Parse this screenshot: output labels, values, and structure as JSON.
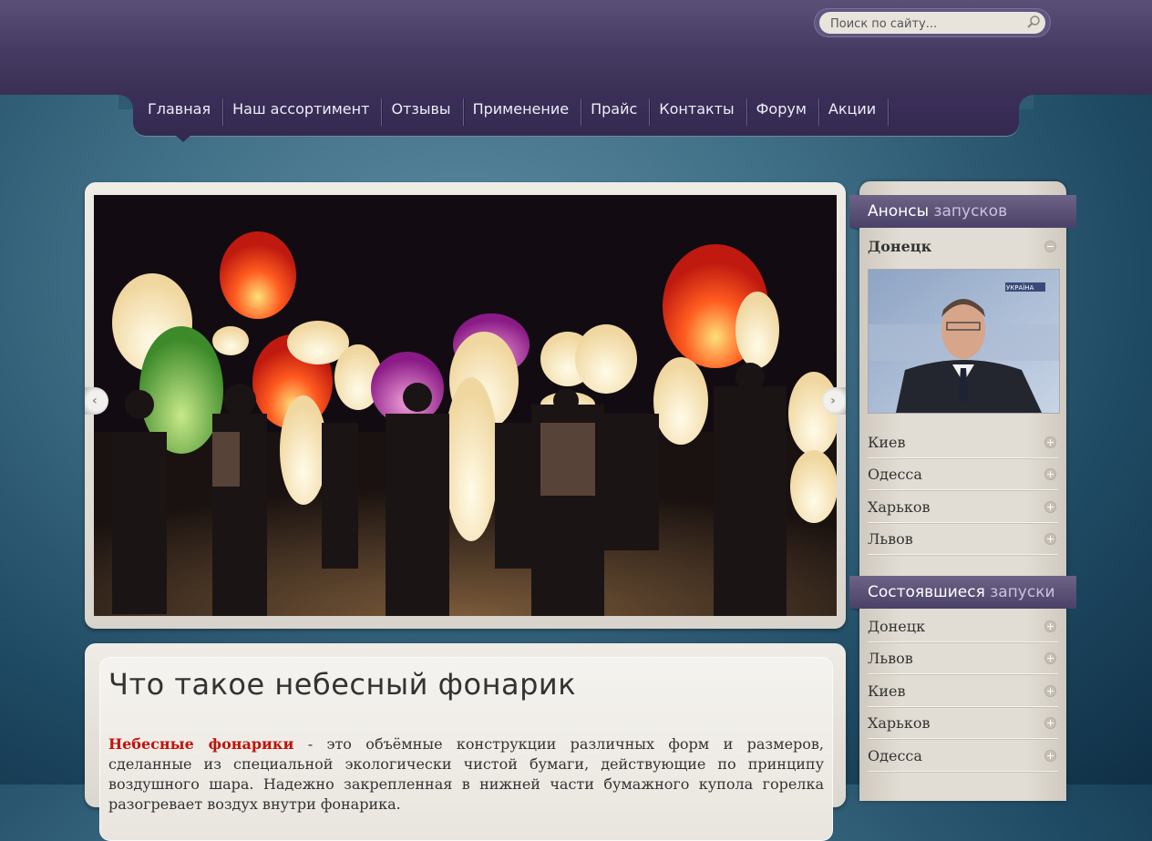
{
  "search": {
    "placeholder": "Поиск по сайту..."
  },
  "nav": {
    "items": [
      {
        "label": "Главная"
      },
      {
        "label": "Наш ассортимент"
      },
      {
        "label": "Отзывы"
      },
      {
        "label": "Применение"
      },
      {
        "label": "Прайс"
      },
      {
        "label": "Контакты"
      },
      {
        "label": "Форум"
      },
      {
        "label": "Акции"
      }
    ],
    "active_index": 0
  },
  "slider": {
    "prev_glyph": "‹",
    "next_glyph": "›",
    "image": "sky lanterns being released at night"
  },
  "article": {
    "title": "Что такое небесный фонарик",
    "highlight": "Небесные фонарики",
    "text": " - это объёмные конструкции различных форм и размеров, сделанные из специальной экологически чистой бумаги, действующие по принципу воздушного шара. Надежно закрепленная в нижней части бумажного купола горелка разогревает воздух внутри фонарика."
  },
  "sidebar": {
    "announcements": {
      "title_first": "Анонсы",
      "title_rest": " запусков",
      "expanded": "Донецк",
      "items": [
        "Киев",
        "Одесса",
        "Харьков",
        "Львов"
      ]
    },
    "completed": {
      "title_first": "Состоявшиеся",
      "title_rest": " запуски",
      "items": [
        "Донецк",
        "Львов",
        "Киев",
        "Харьков",
        "Одесса"
      ]
    },
    "video_channel_logo": "УКРАЇНА"
  },
  "colors": {
    "header": "#453a62",
    "nav": "#3b2f59",
    "highlight_red": "#c0130c",
    "panel": "#e9e5de"
  }
}
